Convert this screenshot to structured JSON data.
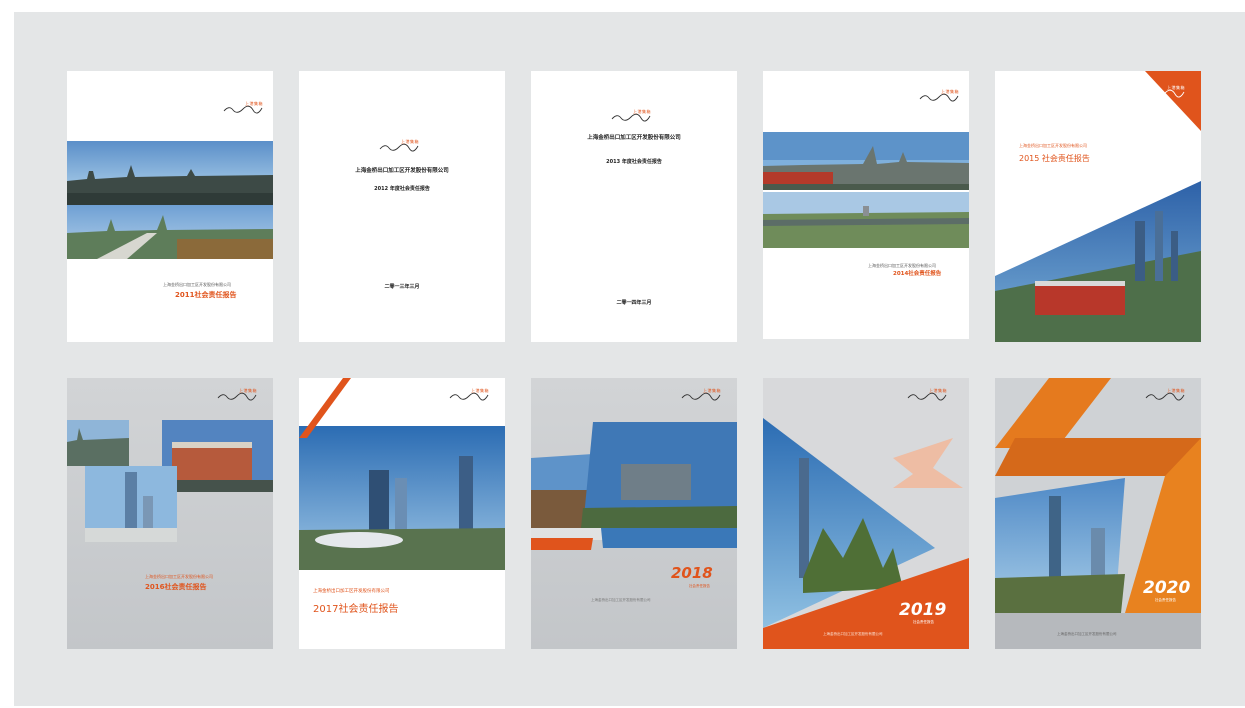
{
  "logo": {
    "cn": "上港集箱",
    "script": "Golden Bridge"
  },
  "covers": [
    {
      "id": "2011",
      "company": "上海金桥出口加工区开发股份有限公司",
      "title": "2011社会责任报告"
    },
    {
      "id": "2012",
      "company": "上海金桥出口加工区开发股份有限公司",
      "title": "2012 年度社会责任报告",
      "date": "二零一三年三月"
    },
    {
      "id": "2013",
      "company": "上海金桥出口加工区开发股份有限公司",
      "title": "2013 年度社会责任报告",
      "date": "二零一四年三月"
    },
    {
      "id": "2014",
      "company": "上海金桥出口加工区开发股份有限公司",
      "title": "2014社会责任报告"
    },
    {
      "id": "2015",
      "company": "上海金桥出口加工区开发股份有限公司",
      "title": "2015 社会责任报告"
    },
    {
      "id": "2016",
      "company": "上海金桥出口加工区开发股份有限公司",
      "title": "2016社会责任报告"
    },
    {
      "id": "2017",
      "company": "上海金桥出口加工区开发股份有限公司",
      "title": "2017社会责任报告"
    },
    {
      "id": "2018",
      "year": "2018",
      "subtitle": "社会责任报告",
      "company": "上海金桥出口加工区开发股份有限公司"
    },
    {
      "id": "2019",
      "year": "2019",
      "subtitle": "社会责任报告",
      "company": "上海金桥出口加工区开发股份有限公司"
    },
    {
      "id": "2020",
      "year": "2020",
      "subtitle": "社会责任报告",
      "company": "上海金桥出口加工区开发股份有限公司"
    }
  ],
  "colors": {
    "accent": "#e0541c",
    "board": "#e4e6e7",
    "sky": "#3a78b8"
  }
}
